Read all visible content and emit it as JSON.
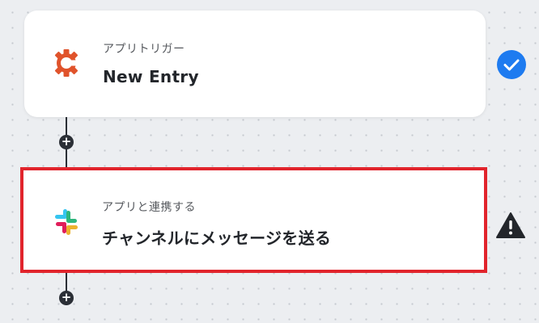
{
  "flow": {
    "steps": [
      {
        "label": "アプリトリガー",
        "title": "New Entry",
        "app_icon": "cognito-forms-icon",
        "status": "success",
        "status_icon": "check-circle-icon",
        "status_color": "#1e7bf0"
      },
      {
        "label": "アプリと連携する",
        "title": "チャンネルにメッセージを送る",
        "app_icon": "slack-icon",
        "status": "warning",
        "status_icon": "warning-triangle-icon",
        "status_color": "#23262b",
        "highlight_color": "#e1242c"
      }
    ],
    "add_step_icon": "plus-icon",
    "add_step_symbol": "+"
  }
}
